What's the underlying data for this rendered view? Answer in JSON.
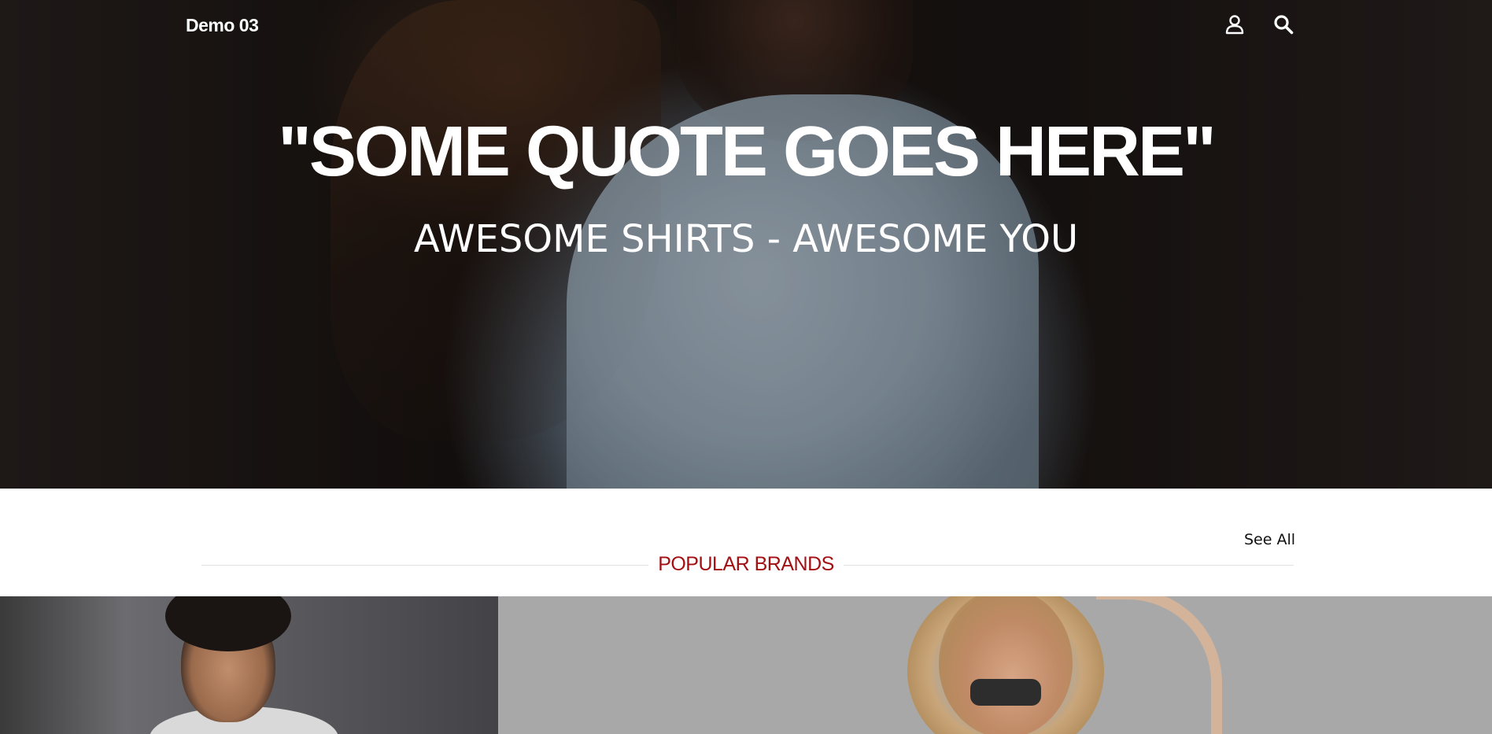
{
  "header": {
    "brand": "Demo 03",
    "icons": [
      "user-icon",
      "search-icon"
    ]
  },
  "hero": {
    "quote": "\"SOME QUOTE GOES HERE\"",
    "tagline": "AWESOME SHIRTS - AWESOME YOU"
  },
  "section": {
    "title": "POPULAR BRANDS",
    "see_all": "See All"
  },
  "colors": {
    "accent": "#a30f12",
    "text_white": "#ffffff",
    "divider": "#e2e2e2"
  }
}
